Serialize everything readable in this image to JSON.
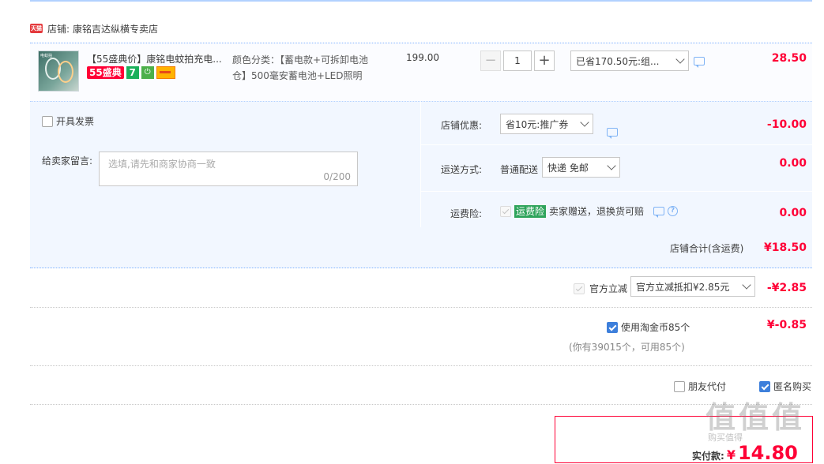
{
  "store": {
    "badge": "天猫",
    "label": "店铺:",
    "name": "康铭吉达纵横专卖店"
  },
  "item": {
    "title": "【55盛典价】康铭电蚊拍充电...",
    "thumb_tag": "电蚊拍",
    "badge_55": "55盛典",
    "badge_7": "7",
    "sku_line1": "颜色分类：【蓄电款+可拆卸电池",
    "sku_line2": "仓】500毫安蓄电池+LED照明",
    "price": "199.00",
    "quantity": "1",
    "discount_select": "已省170.50元:组...",
    "subtotal": "28.50"
  },
  "invoice": {
    "label": "开具发票"
  },
  "memo": {
    "label": "给卖家留言:",
    "placeholder": "选填,请先和商家协商一致",
    "counter": "0/200"
  },
  "shop_coupon": {
    "label": "店铺优惠:",
    "select": "省10元:推广券",
    "amount": "-10.00"
  },
  "shipping": {
    "label": "运送方式:",
    "method": "普通配送",
    "select": "快递 免邮",
    "amount": "0.00"
  },
  "insurance": {
    "label": "运费险:",
    "tag": "运费险",
    "desc": "卖家赠送，退换货可赔",
    "amount": "0.00"
  },
  "shop_total": {
    "label": "店铺合计(含运费)",
    "amount": "¥18.50"
  },
  "official": {
    "label": "官方立减",
    "select": "官方立减抵扣¥2.85元",
    "amount": "-¥2.85"
  },
  "coins": {
    "label": "使用淘金币85个",
    "note": "(你有39015个，可用85个)",
    "amount": "¥-0.85"
  },
  "friend_pay": {
    "label": "朋友代付"
  },
  "anonymous": {
    "label": "匿名购买"
  },
  "payment": {
    "label": "实付款:",
    "currency": "¥",
    "amount": "14.80"
  },
  "watermark": {
    "text": "值值值",
    "sub": "购买值得"
  },
  "colors": {
    "accent_red": "#ff0036",
    "panel_bg": "#f2f7ff",
    "link_blue": "#3d7fdb"
  }
}
